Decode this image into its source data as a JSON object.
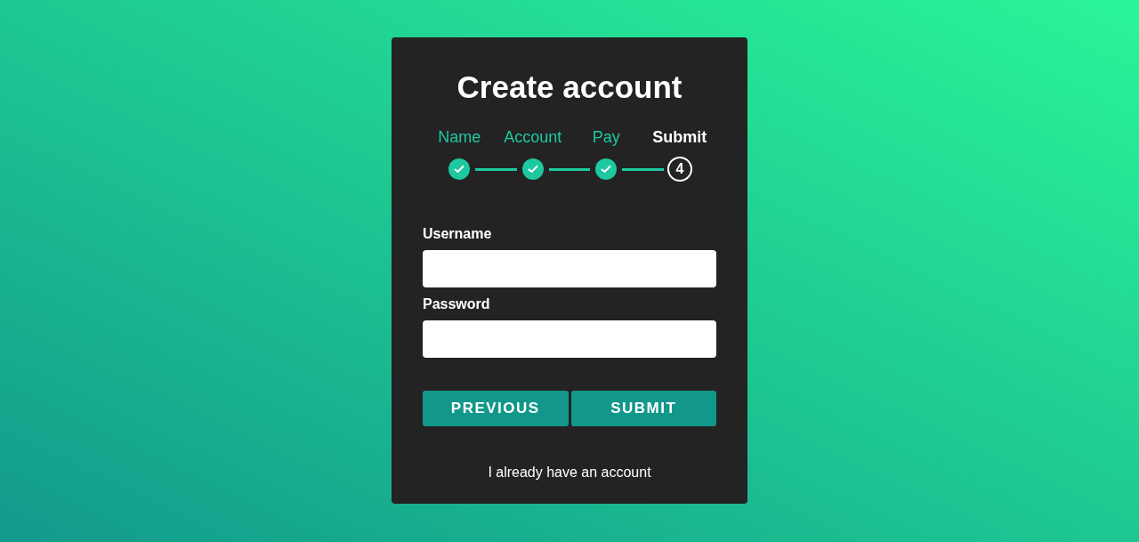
{
  "title": "Create account",
  "steps": [
    {
      "label": "Name",
      "done": true
    },
    {
      "label": "Account",
      "done": true
    },
    {
      "label": "Pay",
      "done": true
    },
    {
      "label": "Submit",
      "done": false,
      "number": "4"
    }
  ],
  "fields": [
    {
      "label": "Username"
    },
    {
      "label": "Password"
    }
  ],
  "buttons": [
    "PREVIOUS",
    "SUBMIT"
  ],
  "link": "I already have an account"
}
